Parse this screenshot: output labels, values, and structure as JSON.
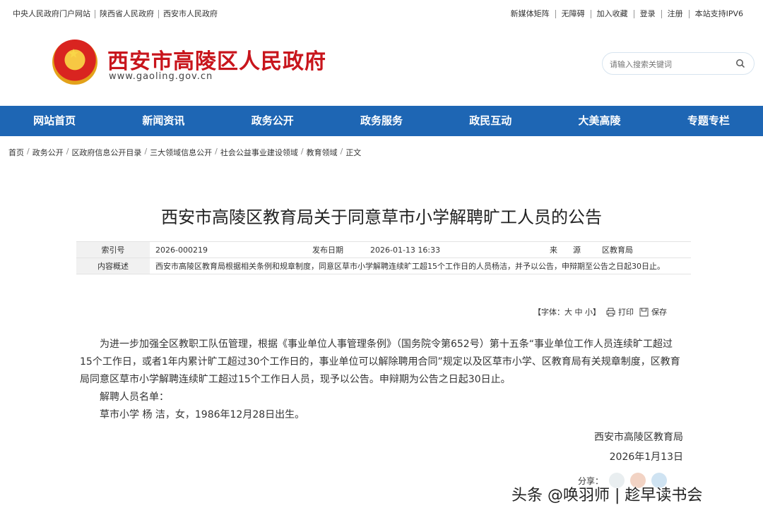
{
  "top_links_left": [
    "中央人民政府门户网站",
    "陕西省人民政府",
    "西安市人民政府"
  ],
  "top_links_right": [
    "新媒体矩阵",
    "无障碍",
    "加入收藏",
    "登录",
    "注册",
    "本站支持IPV6"
  ],
  "header": {
    "site_title": "西安市高陵区人民政府",
    "domain": "www.gaoling.gov.cn",
    "search_placeholder": "请输入搜索关键词"
  },
  "nav": [
    "网站首页",
    "新闻资讯",
    "政务公开",
    "政务服务",
    "政民互动",
    "大美高陵",
    "专题专栏"
  ],
  "breadcrumb": [
    "首页",
    "政务公开",
    "区政府信息公开目录",
    "三大领域信息公开",
    "社会公益事业建设领域",
    "教育领域",
    "正文"
  ],
  "article": {
    "title": "西安市高陵区教育局关于同意草市小学解聘旷工人员的公告",
    "meta": {
      "index_label": "索引号",
      "index_value": "2026-000219",
      "date_label": "发布日期",
      "date_value": "2026-01-13 16:33",
      "source_label": "来　　源",
      "source_value": "区教育局",
      "summary_label": "内容概述",
      "summary_value": "西安市高陵区教育局根据相关条例和规章制度，同意区草市小学解聘连续旷工超15个工作日的人员杨洁，并予以公告，申辩期至公告之日起30日止。"
    },
    "tools": {
      "font_label": "【字体：大 中 小】",
      "print": "打印",
      "save": "保存"
    },
    "para1": "为进一步加强全区教职工队伍管理，根据《事业单位人事管理条例》（国务院令第652号）第十五条“事业单位工作人员连续旷工超过15个工作日，或者1年内累计旷工超过30个工作日的，事业单位可以解除聘用合同”规定以及区草市小学、区教育局有关规章制度，区教育局同意区草市小学解聘连续旷工超过15个工作日人员，现予以公告。申辩期为公告之日起30日止。",
    "para2": "解聘人员名单：",
    "para3": "草市小学 杨 洁，女，1986年12月28日出生。",
    "sign_org": "西安市高陵区教育局",
    "sign_date": "2026年1月13日",
    "share_label": "分享："
  },
  "watermark": "头条 @唤羽师 | 趁早读书会",
  "colors": {
    "nav_bg": "#1e66b4",
    "title_red": "#c8151c",
    "header_bg": "#dcebf8"
  }
}
